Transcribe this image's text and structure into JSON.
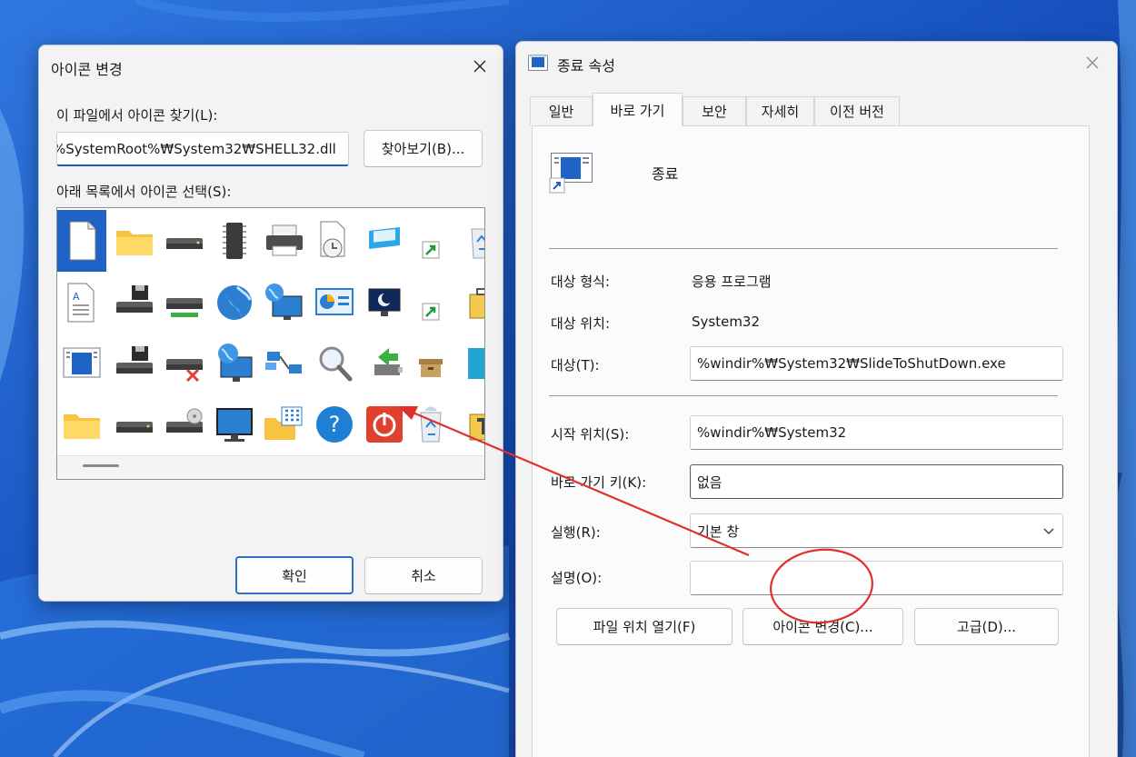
{
  "colors": {
    "wallpaper_base": "#1d5fc9",
    "wallpaper_light": "#7fb8f4",
    "accent": "#1f63c7",
    "annotation": "#e0302e"
  },
  "icon_dialog": {
    "title": "아이콘 변경",
    "find_label": "이 파일에서 아이콘 찾기(L):",
    "path_value": "%SystemRoot%₩System32₩SHELL32.dll",
    "browse_label": "찾아보기(B)...",
    "select_label": "아래 목록에서 아이콘 선택(S):",
    "ok_label": "확인",
    "cancel_label": "취소",
    "icons": [
      [
        "blank-document",
        "folder",
        "drive",
        "memory-chip",
        "printer",
        "document-clock",
        "display-adapter",
        "shortcut-arrow",
        "recycle-bin"
      ],
      [
        "text-document",
        "floppy-drive",
        "network-drive",
        "globe",
        "network-globe",
        "control-panel",
        "monitor-moon",
        "shortcut-arrow",
        "briefcase"
      ],
      [
        "window-app",
        "floppy-drive",
        "drive-x",
        "globe-monitor",
        "network-connections",
        "search-magnifier",
        "usb-arrow",
        "small-box",
        "cyan-tile"
      ],
      [
        "folder",
        "drive",
        "cd-drive",
        "monitor",
        "folder-grid",
        "help",
        "power",
        "recycle-bin-full",
        "tools-folder"
      ]
    ]
  },
  "properties": {
    "title": "종료 속성",
    "tabs": [
      "일반",
      "바로 가기",
      "보안",
      "자세히",
      "이전 버전"
    ],
    "active_tab": "바로 가기",
    "shortcut_name": "종료",
    "target_type_label": "대상 형식:",
    "target_type_value": "응용 프로그램",
    "target_location_label": "대상 위치:",
    "target_location_value": "System32",
    "target_label": "대상(T):",
    "target_value": "%windir%₩System32₩SlideToShutDown.exe",
    "start_in_label": "시작 위치(S):",
    "start_in_value": "%windir%₩System32",
    "shortcut_key_label": "바로 가기 키(K):",
    "shortcut_key_value": "없음",
    "run_label": "실행(R):",
    "run_value": "기본 창",
    "comment_label": "설명(O):",
    "comment_value": "",
    "open_location_label": "파일 위치 열기(F)",
    "change_icon_label": "아이콘 변경(C)...",
    "advanced_label": "고급(D)..."
  }
}
